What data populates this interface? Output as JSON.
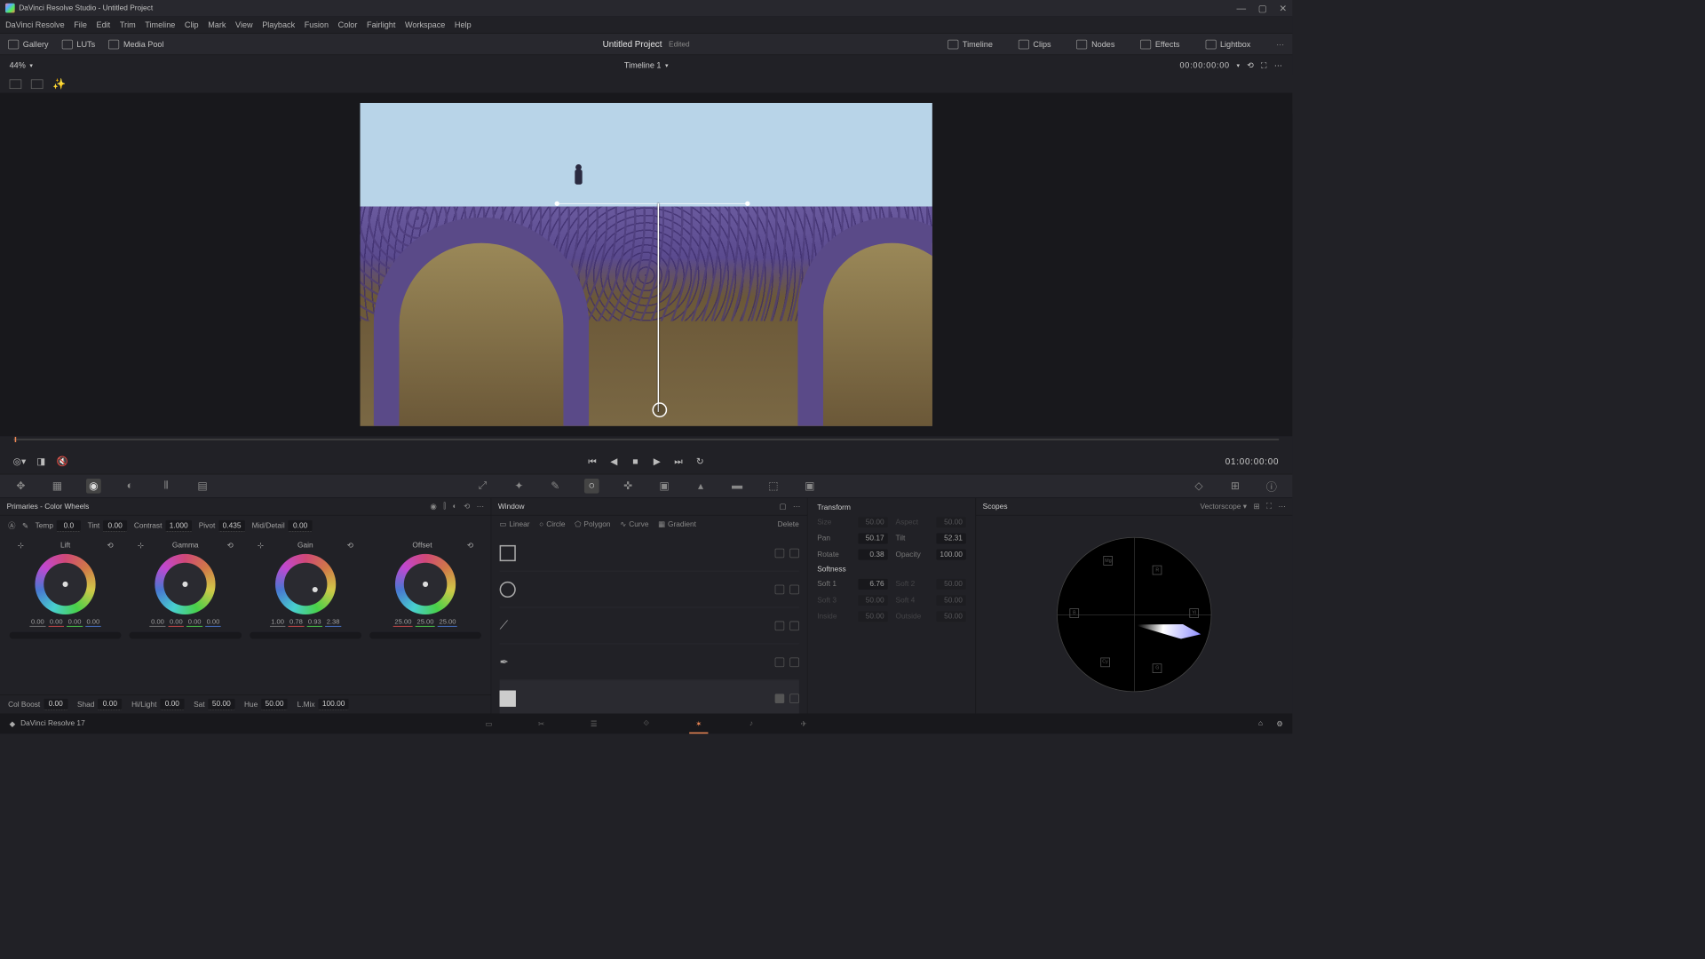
{
  "titlebar": {
    "text": "DaVinci Resolve Studio - Untitled Project"
  },
  "menu": [
    "DaVinci Resolve",
    "File",
    "Edit",
    "Trim",
    "Timeline",
    "Clip",
    "Mark",
    "View",
    "Playback",
    "Fusion",
    "Color",
    "Fairlight",
    "Workspace",
    "Help"
  ],
  "topleft": {
    "gallery": "Gallery",
    "luts": "LUTs",
    "mediapool": "Media Pool"
  },
  "project": {
    "name": "Untitled Project",
    "status": "Edited"
  },
  "topright": {
    "timeline": "Timeline",
    "clips": "Clips",
    "nodes": "Nodes",
    "effects": "Effects",
    "lightbox": "Lightbox"
  },
  "subhdr": {
    "zoom": "44%",
    "timeline_name": "Timeline 1",
    "tc": "00:00:00:00"
  },
  "transport": {
    "tc": "01:00:00:00"
  },
  "primaries": {
    "title": "Primaries - Color Wheels",
    "temp": {
      "lbl": "Temp",
      "val": "0.0"
    },
    "tint": {
      "lbl": "Tint",
      "val": "0.00"
    },
    "contrast": {
      "lbl": "Contrast",
      "val": "1.000"
    },
    "pivot": {
      "lbl": "Pivot",
      "val": "0.435"
    },
    "middetail": {
      "lbl": "Mid/Detail",
      "val": "0.00"
    },
    "wheels": {
      "lift": {
        "lbl": "Lift",
        "vals": [
          "0.00",
          "0.00",
          "0.00",
          "0.00"
        ]
      },
      "gamma": {
        "lbl": "Gamma",
        "vals": [
          "0.00",
          "0.00",
          "0.00",
          "0.00"
        ]
      },
      "gain": {
        "lbl": "Gain",
        "vals": [
          "1.00",
          "0.78",
          "0.93",
          "2.38"
        ]
      },
      "offset": {
        "lbl": "Offset",
        "vals": [
          "25.00",
          "25.00",
          "25.00"
        ]
      }
    },
    "bottom": {
      "colboost": {
        "lbl": "Col Boost",
        "val": "0.00"
      },
      "shad": {
        "lbl": "Shad",
        "val": "0.00"
      },
      "hilight": {
        "lbl": "Hi/Light",
        "val": "0.00"
      },
      "sat": {
        "lbl": "Sat",
        "val": "50.00"
      },
      "hue": {
        "lbl": "Hue",
        "val": "50.00"
      },
      "lmix": {
        "lbl": "L.Mix",
        "val": "100.00"
      }
    }
  },
  "window": {
    "title": "Window",
    "shapes": {
      "linear": "Linear",
      "circle": "Circle",
      "polygon": "Polygon",
      "curve": "Curve",
      "gradient": "Gradient",
      "delete": "Delete"
    }
  },
  "transform": {
    "title": "Transform",
    "size": {
      "lbl": "Size",
      "val": "50.00"
    },
    "aspect": {
      "lbl": "Aspect",
      "val": "50.00"
    },
    "pan": {
      "lbl": "Pan",
      "val": "50.17"
    },
    "tilt": {
      "lbl": "Tilt",
      "val": "52.31"
    },
    "rotate": {
      "lbl": "Rotate",
      "val": "0.38"
    },
    "opacity": {
      "lbl": "Opacity",
      "val": "100.00"
    },
    "softness_title": "Softness",
    "soft1": {
      "lbl": "Soft 1",
      "val": "6.76"
    },
    "soft2": {
      "lbl": "Soft 2",
      "val": "50.00"
    },
    "soft3": {
      "lbl": "Soft 3",
      "val": "50.00"
    },
    "soft4": {
      "lbl": "Soft 4",
      "val": "50.00"
    },
    "inside": {
      "lbl": "Inside",
      "val": "50.00"
    },
    "outside": {
      "lbl": "Outside",
      "val": "50.00"
    }
  },
  "scopes": {
    "title": "Scopes",
    "type": "Vectorscope"
  },
  "footer": {
    "app": "DaVinci Resolve 17"
  }
}
